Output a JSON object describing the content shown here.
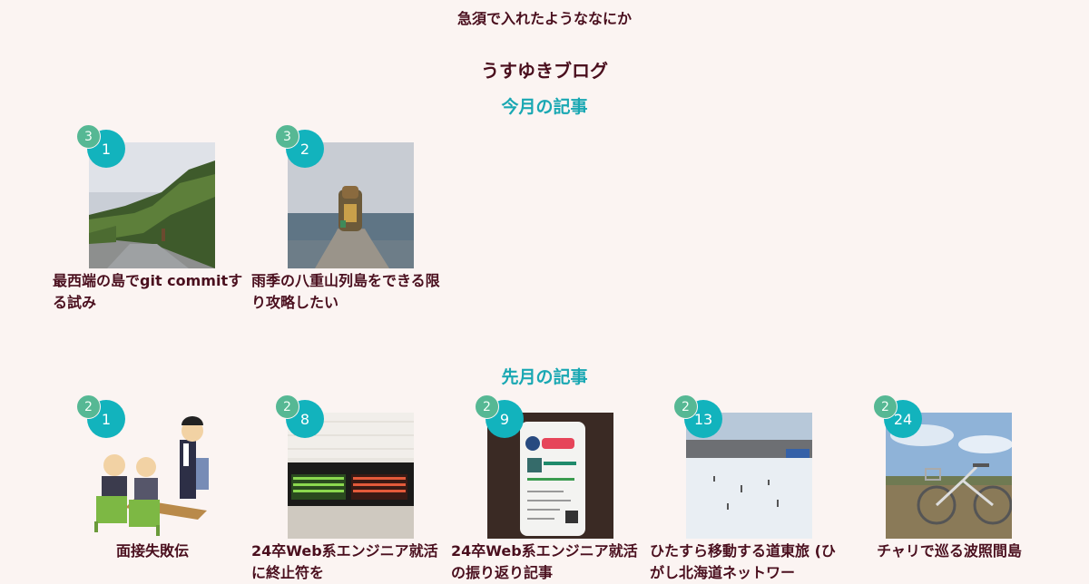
{
  "header": {
    "tagline": "急須で入れたようななにか",
    "blog_title": "うすゆきブログ"
  },
  "sections": [
    {
      "heading": "今月の記事",
      "cards": [
        {
          "count": "3",
          "day": "1",
          "title": "最西端の島でgit commitする試み",
          "thumb": "coastal-road-photo"
        },
        {
          "count": "3",
          "day": "2",
          "title": "雨季の八重山列島をできる限り攻略したい",
          "thumb": "shisa-pier-photo"
        }
      ]
    },
    {
      "heading": "先月の記事",
      "cards": [
        {
          "count": "2",
          "day": "1",
          "title": "面接失敗伝",
          "thumb": "interview-illustration"
        },
        {
          "count": "2",
          "day": "8",
          "title": "24卒Web系エンジニア就活に終止符を",
          "thumb": "station-board-photo"
        },
        {
          "count": "2",
          "day": "9",
          "title": "24卒Web系エンジニア就活の振り返り記事",
          "thumb": "phone-card-photo"
        },
        {
          "count": "2",
          "day": "13",
          "title": "ひたすら移動する道東旅 (ひがし北海道ネットワー",
          "thumb": "snow-field-photo"
        },
        {
          "count": "2",
          "day": "24",
          "title": "チャリで巡る波照間島",
          "thumb": "bicycle-photo"
        }
      ]
    }
  ],
  "colors": {
    "background": "#fbf4f2",
    "text": "#4a0f1e",
    "accent": "#1aa8b3",
    "day_badge": "#12b3bd",
    "count_badge": "#56b894"
  }
}
